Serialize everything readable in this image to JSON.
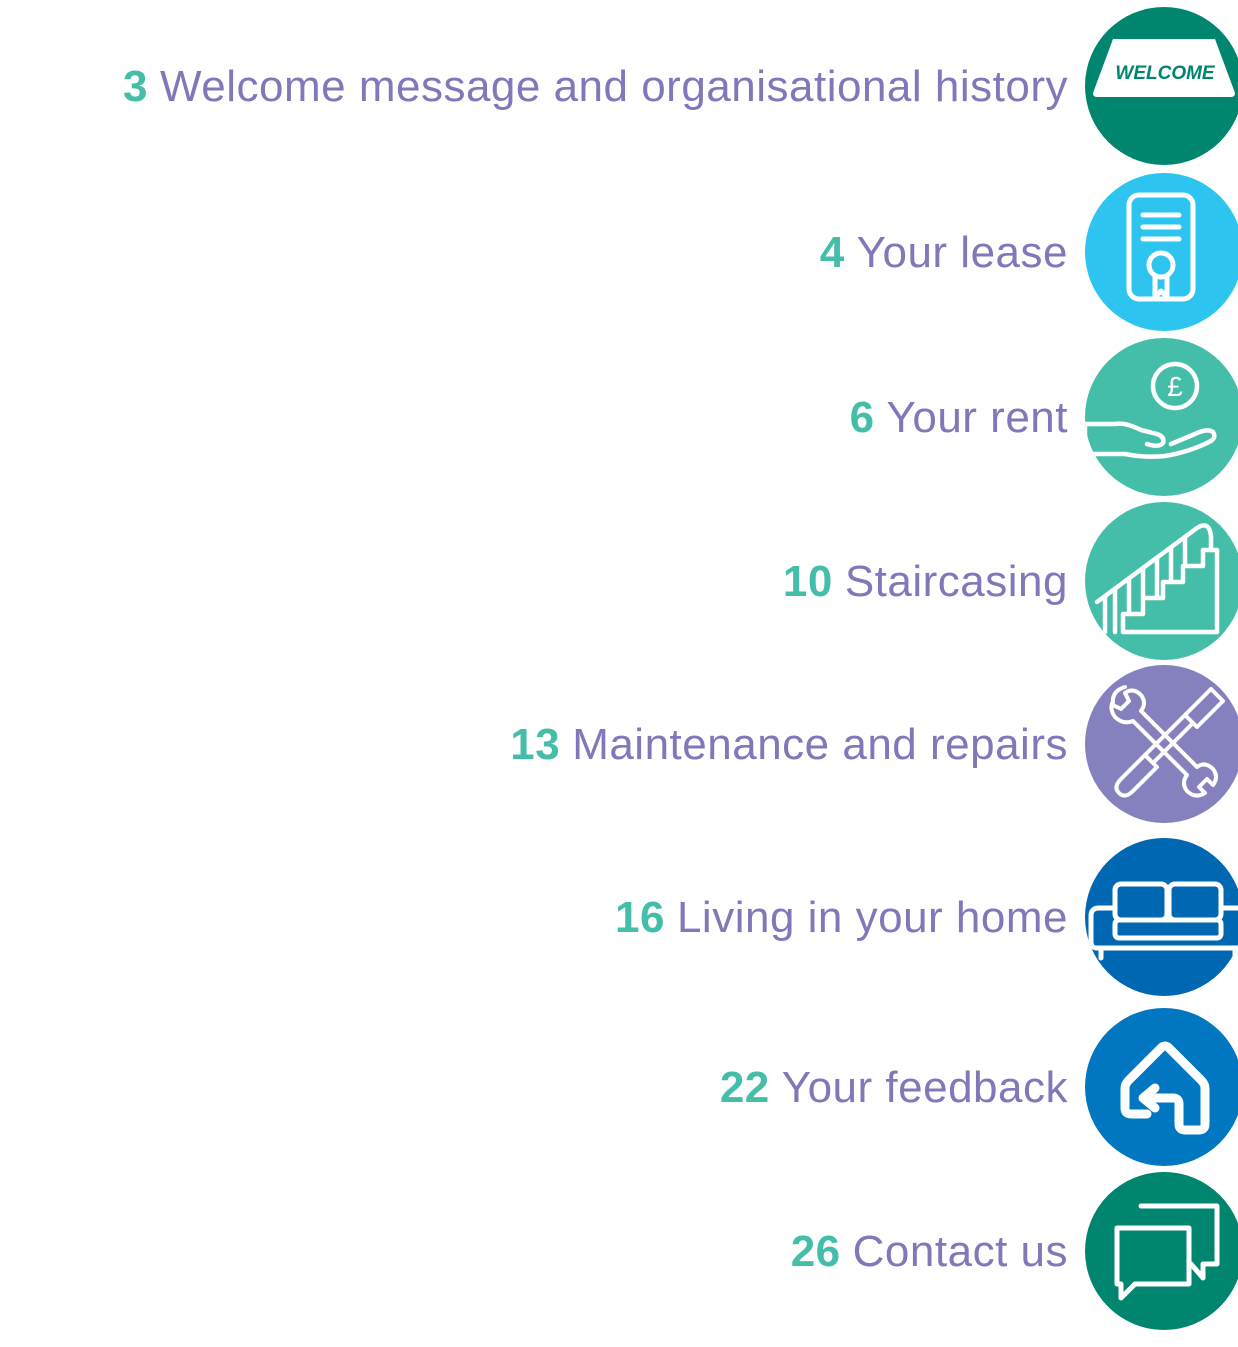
{
  "colors": {
    "label": "#7f78b9",
    "number": "#45bea9"
  },
  "entries": [
    {
      "number": "3",
      "title": "Welcome message and organisational history",
      "icon": "welcome-mat-icon",
      "color": "#00856f",
      "badge_text": "WELCOME"
    },
    {
      "number": "4",
      "title": "Your lease",
      "icon": "certificate-icon",
      "color": "#2dc4f0"
    },
    {
      "number": "6",
      "title": "Your rent",
      "icon": "hand-pound-icon",
      "color": "#45bea9"
    },
    {
      "number": "10",
      "title": "Staircasing",
      "icon": "staircase-icon",
      "color": "#45bea9"
    },
    {
      "number": "13",
      "title": "Maintenance and repairs",
      "icon": "tools-icon",
      "color": "#8581be"
    },
    {
      "number": "16",
      "title": "Living in your home",
      "icon": "sofa-icon",
      "color": "#0068b2"
    },
    {
      "number": "22",
      "title": "Your feedback",
      "icon": "house-feedback-icon",
      "color": "#0077c0"
    },
    {
      "number": "26",
      "title": "Contact us",
      "icon": "chat-bubbles-icon",
      "color": "#00856f"
    }
  ]
}
